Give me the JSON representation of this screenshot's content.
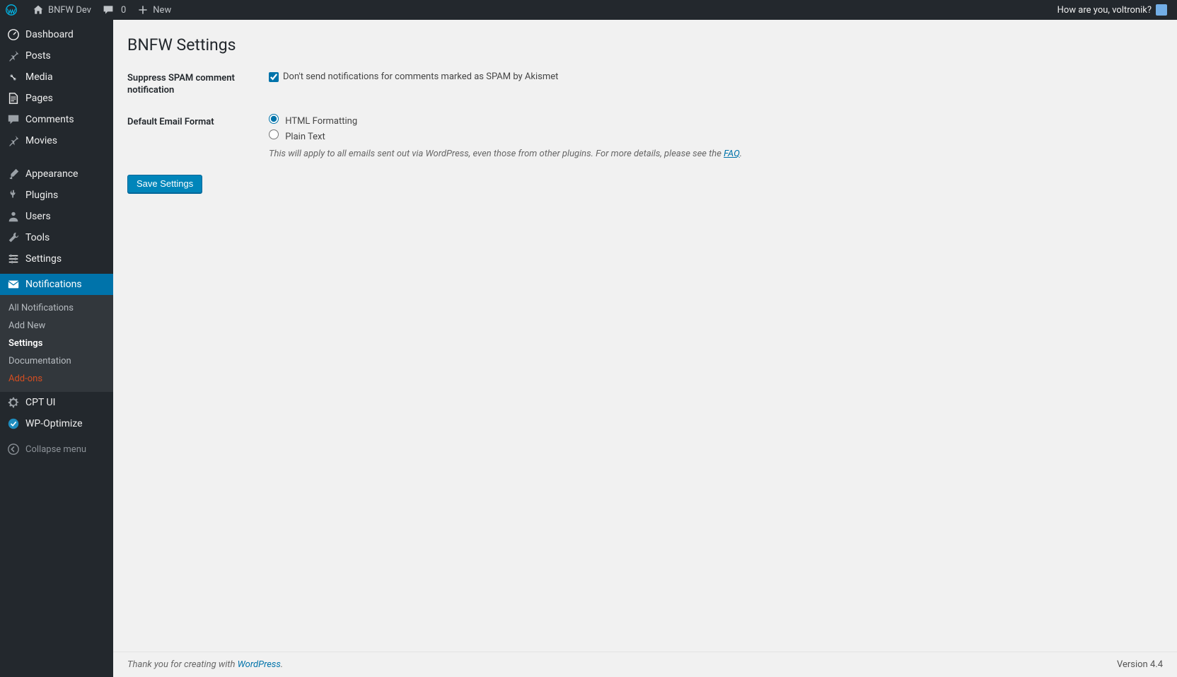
{
  "adminbar": {
    "site_name": "BNFW Dev",
    "comments_count": "0",
    "new_label": "New",
    "greeting": "How are you, voltronik?"
  },
  "sidebar": {
    "items": [
      {
        "id": "dashboard",
        "label": "Dashboard",
        "icon": "dashboard"
      },
      {
        "id": "posts",
        "label": "Posts",
        "icon": "pin"
      },
      {
        "id": "media",
        "label": "Media",
        "icon": "media"
      },
      {
        "id": "pages",
        "label": "Pages",
        "icon": "page"
      },
      {
        "id": "comments",
        "label": "Comments",
        "icon": "comment"
      },
      {
        "id": "movies",
        "label": "Movies",
        "icon": "pin"
      }
    ],
    "items2": [
      {
        "id": "appearance",
        "label": "Appearance",
        "icon": "brush"
      },
      {
        "id": "plugins",
        "label": "Plugins",
        "icon": "plug"
      },
      {
        "id": "users",
        "label": "Users",
        "icon": "user"
      },
      {
        "id": "tools",
        "label": "Tools",
        "icon": "wrench"
      },
      {
        "id": "settings",
        "label": "Settings",
        "icon": "sliders"
      }
    ],
    "current": {
      "id": "notifications",
      "label": "Notifications",
      "icon": "mail"
    },
    "submenu": [
      {
        "label": "All Notifications",
        "active": false
      },
      {
        "label": "Add New",
        "active": false
      },
      {
        "label": "Settings",
        "active": true
      },
      {
        "label": "Documentation",
        "active": false
      },
      {
        "label": "Add-ons",
        "active": false,
        "orange": true
      }
    ],
    "items3": [
      {
        "id": "cptui",
        "label": "CPT UI",
        "icon": "gear"
      },
      {
        "id": "wpopt",
        "label": "WP-Optimize",
        "icon": "check-circle"
      }
    ],
    "collapse_label": "Collapse menu"
  },
  "page": {
    "title": "BNFW Settings",
    "row1_label": "Suppress SPAM comment notification",
    "row1_checkbox_label": "Don't send notifications for comments marked as SPAM by Akismet",
    "row2_label": "Default Email Format",
    "row2_opt1": "HTML Formatting",
    "row2_opt2": "Plain Text",
    "row2_desc_pre": "This will apply to all emails sent out via WordPress, even those from other plugins. For more details, please see the ",
    "row2_desc_link": "FAQ",
    "save_label": "Save Settings"
  },
  "footer": {
    "thank_pre": "Thank you for creating with ",
    "thank_link": "WordPress",
    "version": "Version 4.4"
  }
}
